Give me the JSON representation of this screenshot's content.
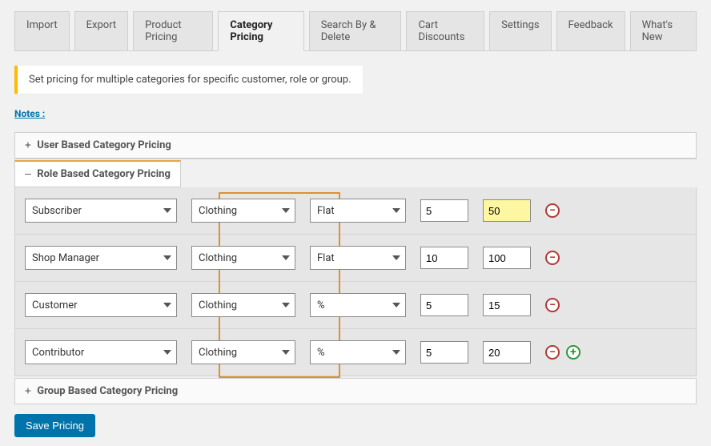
{
  "tabs": {
    "items": [
      {
        "label": "Import"
      },
      {
        "label": "Export"
      },
      {
        "label": "Product Pricing"
      },
      {
        "label": "Category Pricing"
      },
      {
        "label": "Search By & Delete"
      },
      {
        "label": "Cart Discounts"
      },
      {
        "label": "Settings"
      },
      {
        "label": "Feedback"
      },
      {
        "label": "What's New"
      }
    ],
    "active_index": 3
  },
  "notice": "Set pricing for multiple categories for specific customer, role or group.",
  "notes_link": "Notes :",
  "sections": {
    "user": {
      "title": "User Based Category Pricing",
      "open": false
    },
    "role": {
      "title": "Role Based Category Pricing",
      "open": true
    },
    "group": {
      "title": "Group Based Category Pricing",
      "open": false
    }
  },
  "rules": [
    {
      "role": "Subscriber",
      "category": "Clothing",
      "type": "Flat",
      "min": "5",
      "value": "50",
      "value_highlight": true,
      "can_add": false
    },
    {
      "role": "Shop Manager",
      "category": "Clothing",
      "type": "Flat",
      "min": "10",
      "value": "100",
      "value_highlight": false,
      "can_add": false
    },
    {
      "role": "Customer",
      "category": "Clothing",
      "type": "%",
      "min": "5",
      "value": "15",
      "value_highlight": false,
      "can_add": false
    },
    {
      "role": "Contributor",
      "category": "Clothing",
      "type": "%",
      "min": "5",
      "value": "20",
      "value_highlight": false,
      "can_add": true
    }
  ],
  "save_label": "Save Pricing",
  "toggles": {
    "plus": "+",
    "minus": "–"
  },
  "icons": {
    "remove": "−",
    "add": "+"
  }
}
